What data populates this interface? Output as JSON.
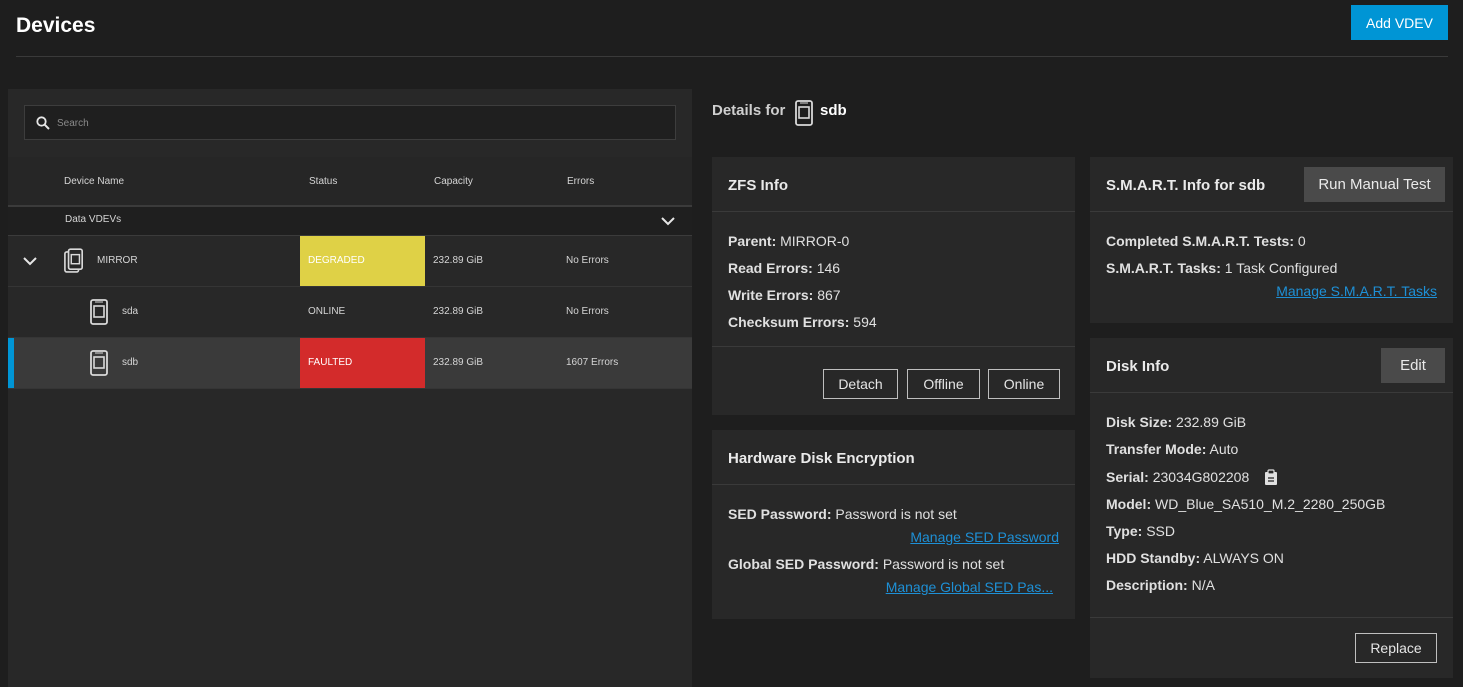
{
  "header": {
    "title": "Devices",
    "add_vdev_label": "Add VDEV"
  },
  "search": {
    "placeholder": "Search",
    "icon": "search-icon"
  },
  "table": {
    "columns": [
      "Device Name",
      "Status",
      "Capacity",
      "Errors"
    ],
    "group_label": "Data VDEVs",
    "rows": [
      {
        "name": "MIRROR",
        "status": "DEGRADED",
        "capacity": "232.89 GiB",
        "errors": "No Errors",
        "status_color": "#dfd146"
      },
      {
        "name": "sda",
        "status": "ONLINE",
        "capacity": "232.89 GiB",
        "errors": "No Errors",
        "status_color": ""
      },
      {
        "name": "sdb",
        "status": "FAULTED",
        "capacity": "232.89 GiB",
        "errors": "1607 Errors",
        "status_color": "#d32b2b"
      }
    ]
  },
  "details": {
    "prefix": "Details for",
    "device": "sdb"
  },
  "zfs": {
    "title": "ZFS Info",
    "parent_label": "Parent:",
    "parent": "MIRROR-0",
    "read_label": "Read Errors:",
    "read": "146",
    "write_label": "Write Errors:",
    "write": "867",
    "checksum_label": "Checksum Errors:",
    "checksum": "594",
    "detach": "Detach",
    "offline": "Offline",
    "online": "Online"
  },
  "hde": {
    "title": "Hardware Disk Encryption",
    "sed_label": "SED Password:",
    "sed": "Password is not set",
    "manage_sed": "Manage SED Password",
    "global_label": "Global SED Password:",
    "global": "Password is not set",
    "manage_global": "Manage Global SED Pas..."
  },
  "smart": {
    "title": "S.M.A.R.T. Info for sdb",
    "run_test": "Run Manual Test",
    "completed_label": "Completed S.M.A.R.T. Tests:",
    "completed": "0",
    "tasks_label": "S.M.A.R.T. Tasks:",
    "tasks": "1 Task Configured",
    "manage_tasks": "Manage S.M.A.R.T. Tasks"
  },
  "disk": {
    "title": "Disk Info",
    "edit": "Edit",
    "size_label": "Disk Size:",
    "size": "232.89 GiB",
    "transfer_label": "Transfer Mode:",
    "transfer": "Auto",
    "serial_label": "Serial:",
    "serial": "23034G802208",
    "model_label": "Model:",
    "model": "WD_Blue_SA510_M.2_2280_250GB",
    "type_label": "Type:",
    "type": "SSD",
    "standby_label": "HDD Standby:",
    "standby": "ALWAYS ON",
    "desc_label": "Description:",
    "desc": "N/A",
    "replace": "Replace"
  },
  "colors": {
    "accent": "#0095d5",
    "degraded": "#dfd146",
    "faulted": "#d32b2b"
  }
}
